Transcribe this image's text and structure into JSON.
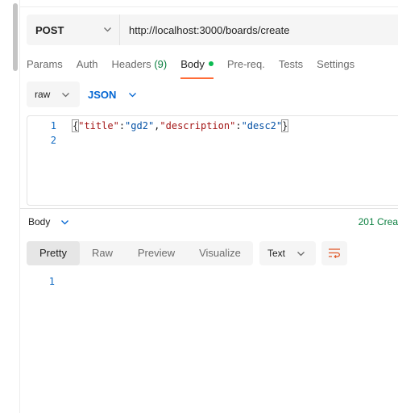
{
  "request": {
    "method": "POST",
    "url": "http://localhost:3000/boards/create"
  },
  "tabs": {
    "params": "Params",
    "auth": "Auth",
    "headers": "Headers",
    "headers_count": "(9)",
    "body": "Body",
    "prereq": "Pre-req.",
    "tests": "Tests",
    "settings": "Settings",
    "active": "Body"
  },
  "body_mode": {
    "mode": "raw",
    "language": "JSON"
  },
  "editor": {
    "line_numbers": [
      "1",
      "2"
    ],
    "line1": {
      "open": "{",
      "key1": "\"title\"",
      "colon1": ":",
      "val1": "\"gd2\"",
      "comma": ",",
      "key2": "\"description\"",
      "colon2": ":",
      "val2": "\"desc2\"",
      "close": "}"
    }
  },
  "response": {
    "section_label": "Body",
    "status": "201 Crea",
    "view_tabs": [
      "Pretty",
      "Raw",
      "Preview",
      "Visualize"
    ],
    "active_view": "Pretty",
    "format": "Text",
    "line_numbers": [
      "1"
    ]
  },
  "colors": {
    "accent": "#ff6c37",
    "link_blue": "#0265d2",
    "success_green": "#0a7f3f",
    "wrap_icon": "#e05a2b"
  },
  "icons": {
    "chevron": "chevron-down-icon",
    "wrap": "word-wrap-icon"
  }
}
